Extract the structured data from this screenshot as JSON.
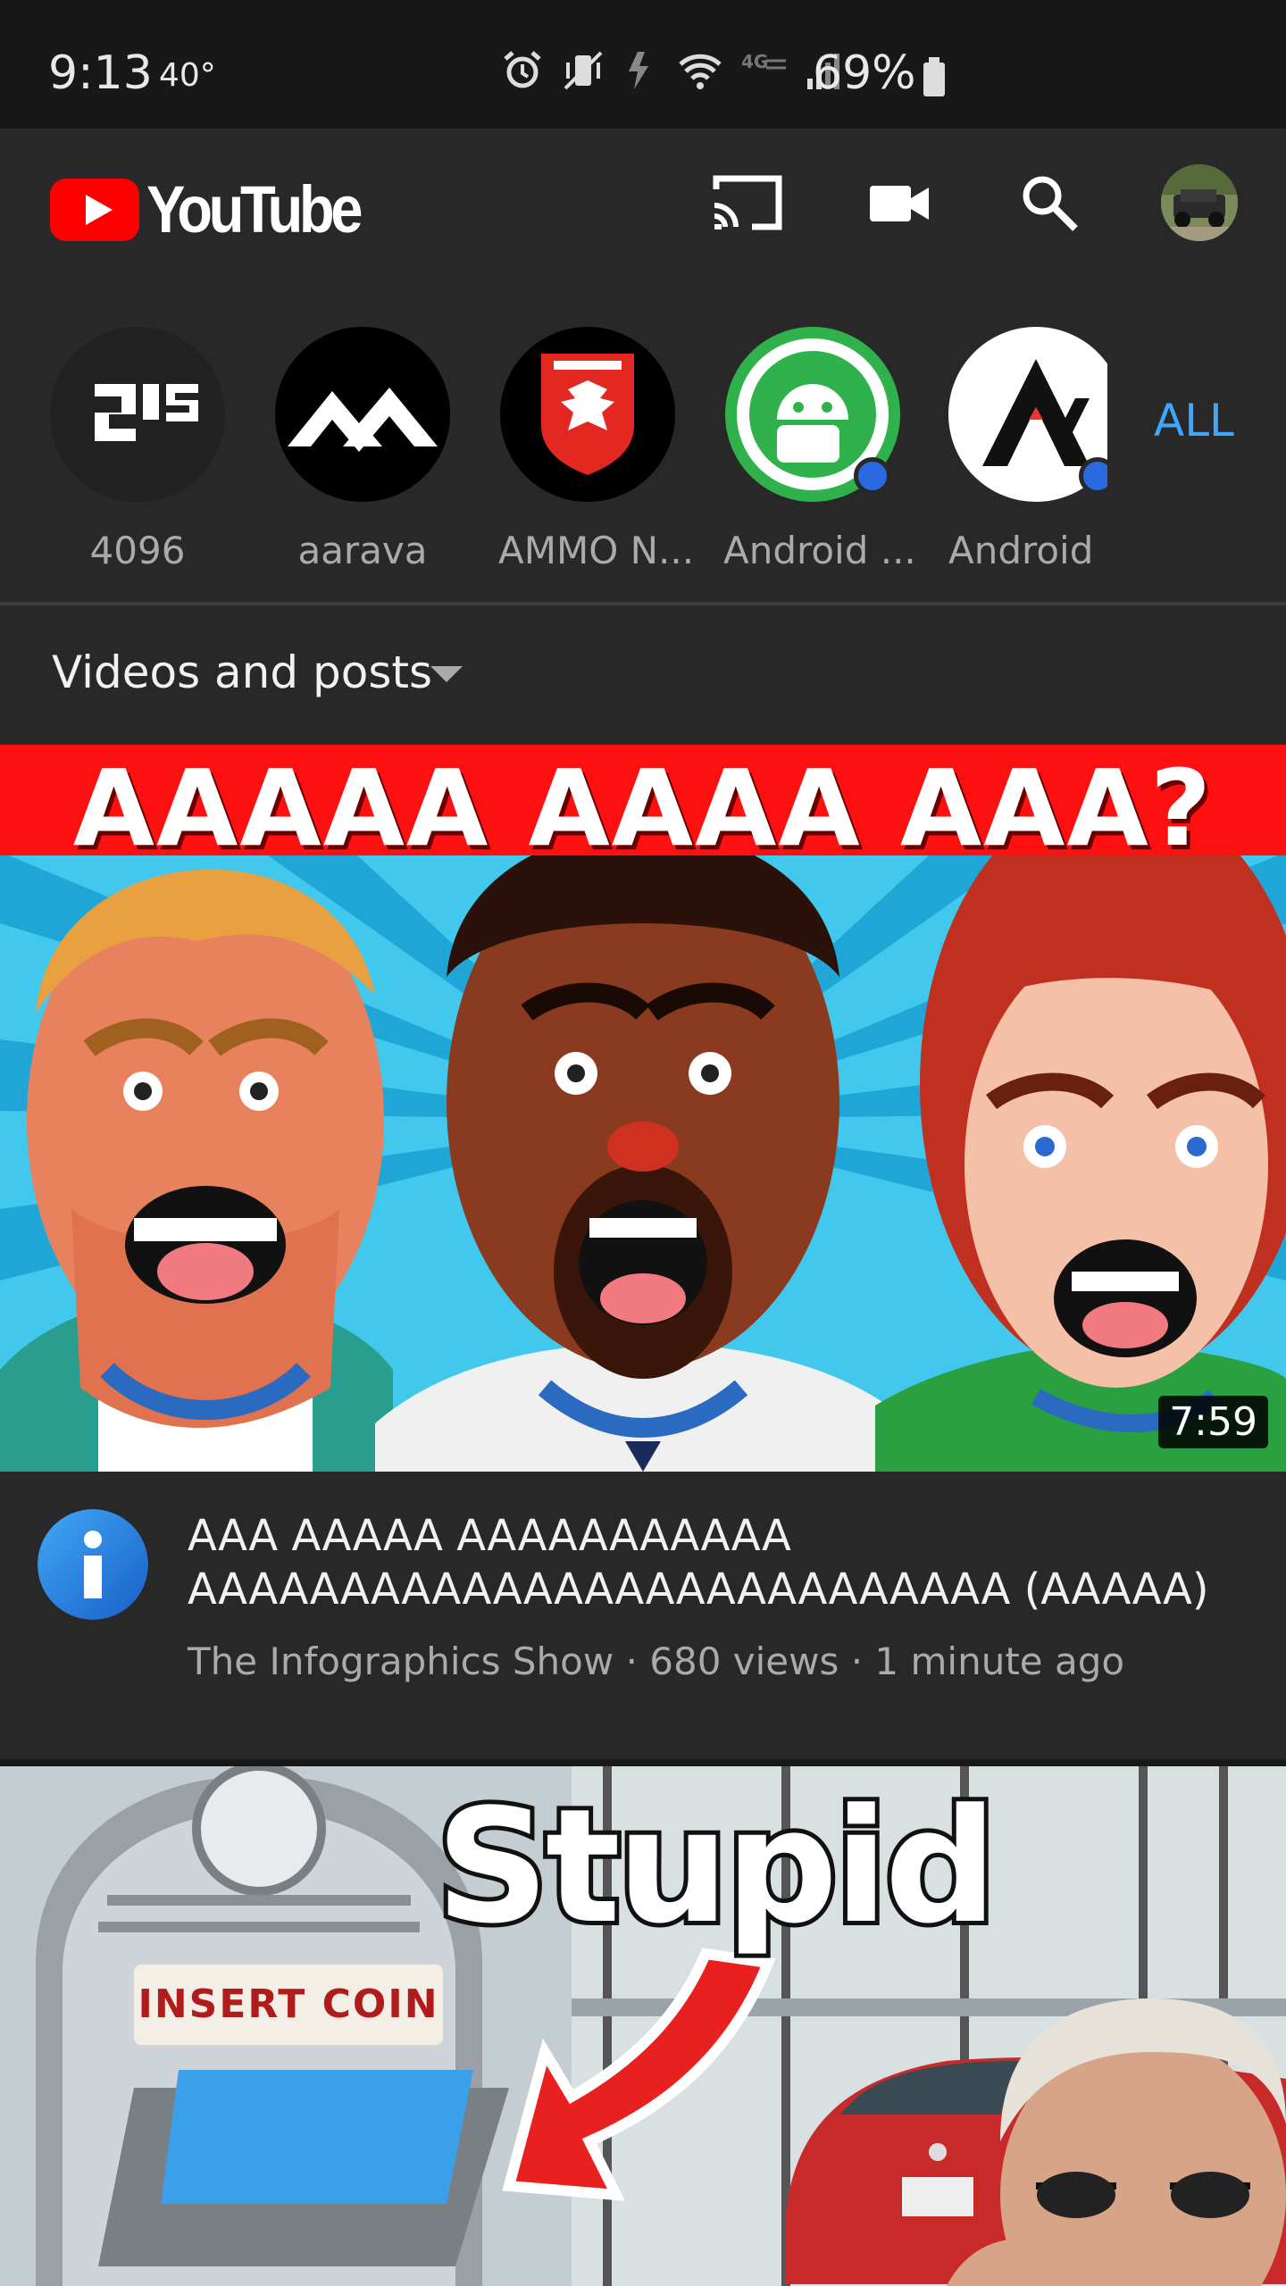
{
  "status_bar": {
    "time": "9:13",
    "temperature": "40°",
    "battery_percent": "69%",
    "icons": [
      "alarm-icon",
      "vibrate-icon",
      "data-transfer-icon",
      "wifi-icon",
      "lte-icon",
      "signal-icon",
      "battery-icon"
    ]
  },
  "app_bar": {
    "logo_text": "YouTube",
    "actions": [
      "cast-icon",
      "camera-icon",
      "search-icon",
      "account-avatar"
    ]
  },
  "subscriptions": {
    "channels": [
      {
        "label": "4096",
        "has_new": false
      },
      {
        "label": "aarava",
        "has_new": false
      },
      {
        "label": "AMMO N...",
        "has_new": false
      },
      {
        "label": "Android ...",
        "has_new": true
      },
      {
        "label": "Android .",
        "has_new": true
      }
    ],
    "all_label": "ALL"
  },
  "filter": {
    "label": "Videos and posts"
  },
  "videos": [
    {
      "thumbnail_banner": "AAAAA AAAA AAA?",
      "duration": "7:59",
      "title": "AAA AAAAA AAAAAAAAAAA AAAAAAAAAAAAAAAAAAAAAAAAAAA (AAAAA)",
      "subline": "The Infographics Show · 680 views · 1 minute ago"
    },
    {
      "thumbnail_word": "Stupid",
      "thumbnail_sign": "INSERT COIN"
    }
  ],
  "colors": {
    "background": "#181818",
    "surface": "#282828",
    "accent_blue": "#3ea6ff",
    "youtube_red": "#ff0000"
  }
}
